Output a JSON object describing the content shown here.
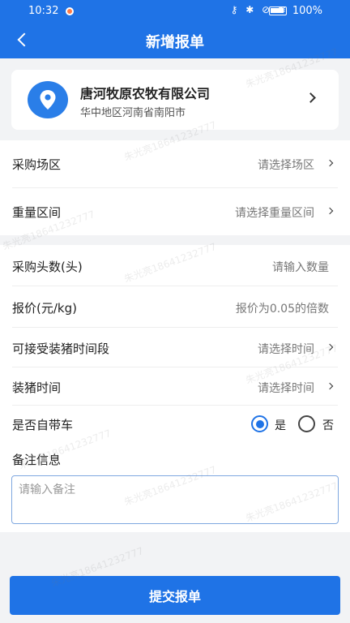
{
  "status_bar": {
    "time": "10:32",
    "battery": "100%"
  },
  "header": {
    "title": "新增报单"
  },
  "company": {
    "name": "唐河牧原农牧有限公司",
    "region": "华中地区河南省南阳市"
  },
  "form": {
    "area": {
      "label": "采购场区",
      "placeholder": "请选择场区"
    },
    "weight": {
      "label": "重量区间",
      "placeholder": "请选择重量区间"
    },
    "count": {
      "label": "采购头数(头)",
      "placeholder": "请输入数量"
    },
    "price": {
      "label": "报价(元/kg)",
      "placeholder": "报价为0.05的倍数"
    },
    "time_range": {
      "label": "可接受装猪时间段",
      "placeholder": "请选择时间"
    },
    "load_time": {
      "label": "装猪时间",
      "placeholder": "请选择时间"
    },
    "own_truck": {
      "label": "是否自带车",
      "options": [
        "是",
        "否"
      ],
      "selected": "是"
    },
    "note": {
      "label": "备注信息",
      "placeholder": "请输入备注"
    }
  },
  "submit_label": "提交报单",
  "watermark": "朱光亮18641232777",
  "colors": {
    "primary": "#1f73e6"
  }
}
